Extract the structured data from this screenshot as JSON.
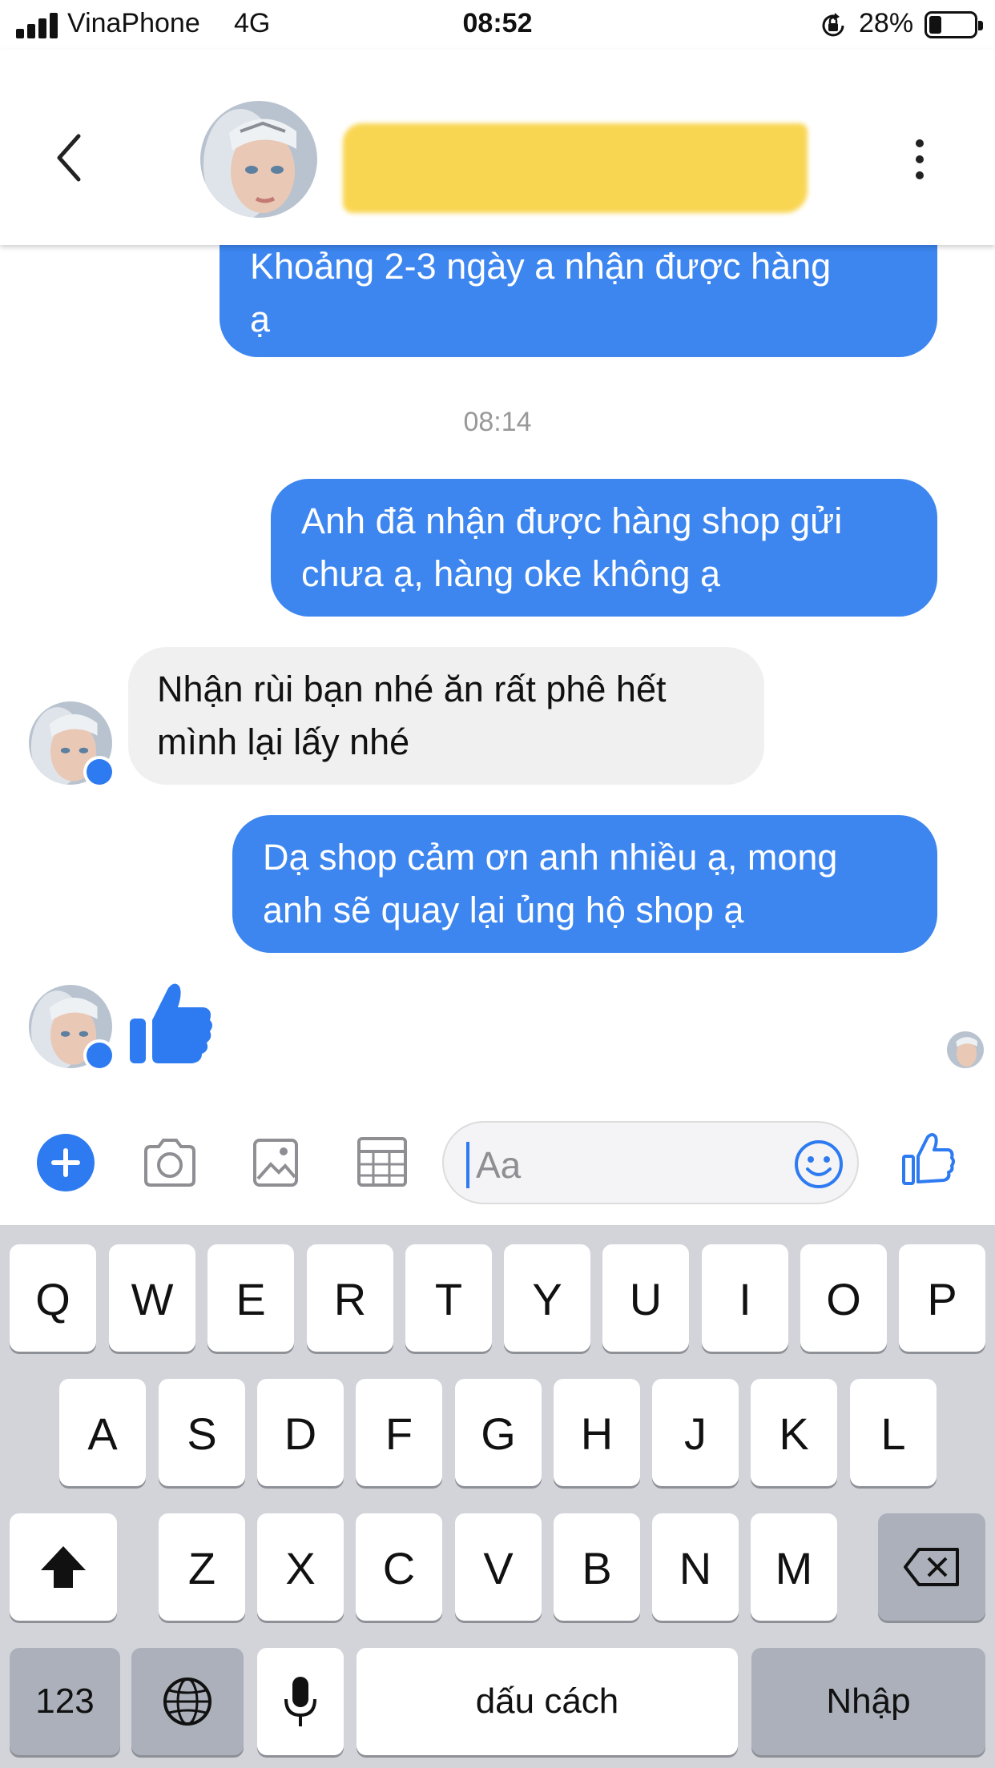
{
  "status_bar": {
    "carrier": "VinaPhone",
    "network": "4G",
    "time": "08:52",
    "battery_percent": "28%",
    "battery_level": 0.28
  },
  "header": {
    "back_icon": "chevron-left-icon",
    "contact_name": "",
    "more_icon": "vertical-dots-icon"
  },
  "messages": [
    {
      "side": "outgoing",
      "lines": [
        "Khoảng 2-3 ngày a nhận được hàng",
        "ạ"
      ]
    },
    {
      "side": "timestamp",
      "text": "08:14"
    },
    {
      "side": "outgoing",
      "lines": [
        "Anh đã nhận được hàng shop gửi",
        "chưa ạ, hàng oke không ạ"
      ]
    },
    {
      "side": "incoming",
      "lines": [
        "Nhận rùi bạn nhé ăn rất phê hết",
        "mình lại lấy nhé"
      ]
    },
    {
      "side": "outgoing",
      "lines": [
        "Dạ shop cảm ơn anh nhiều ạ, mong",
        "anh sẽ quay lại ủng hộ shop ạ"
      ]
    },
    {
      "side": "incoming",
      "sticker": "thumbs-up-icon"
    }
  ],
  "composer": {
    "placeholder": "Aa",
    "icons": [
      "plus-icon",
      "camera-icon",
      "image-icon",
      "sticker-grid-icon",
      "emoji-icon",
      "thumbs-up-icon"
    ]
  },
  "keyboard": {
    "row1": [
      "Q",
      "W",
      "E",
      "R",
      "T",
      "Y",
      "U",
      "I",
      "O",
      "P"
    ],
    "row2": [
      "A",
      "S",
      "D",
      "F",
      "G",
      "H",
      "J",
      "K",
      "L"
    ],
    "row3": [
      "Z",
      "X",
      "C",
      "V",
      "B",
      "N",
      "M"
    ],
    "numbers_label": "123",
    "space_label": "dấu cách",
    "return_label": "Nhập"
  },
  "colors": {
    "accent": "#2e7bf1",
    "outgoing_bubble": "#3d86f0",
    "incoming_bubble": "#f0f0f0",
    "redaction": "#f9d652",
    "keyboard_bg": "#d2d4da"
  }
}
